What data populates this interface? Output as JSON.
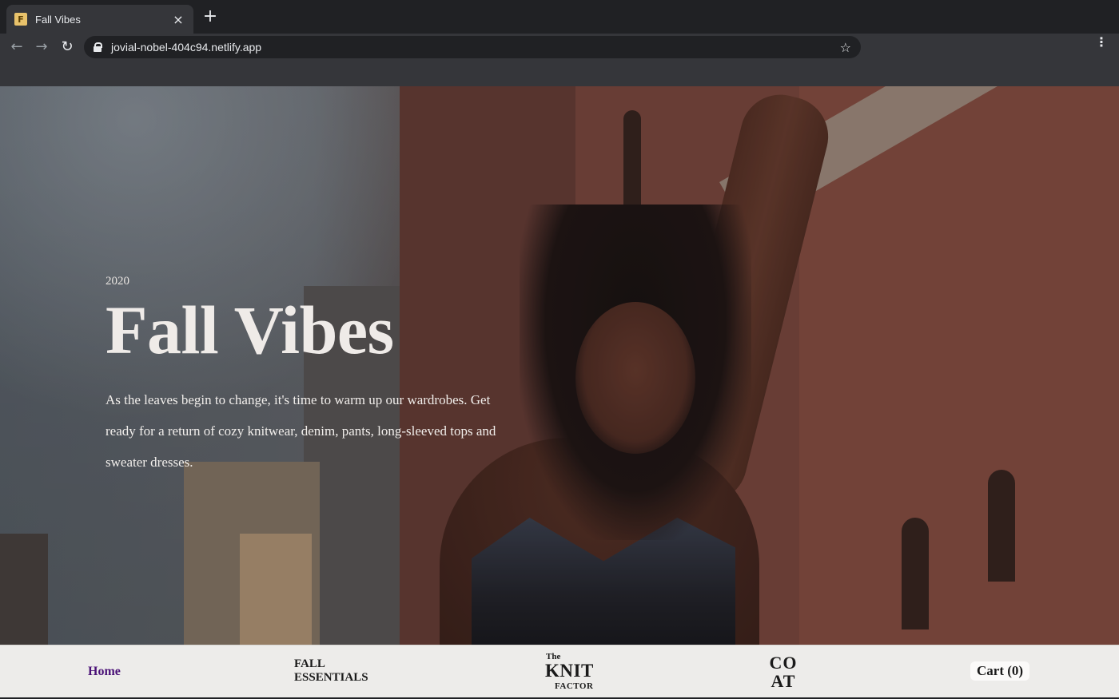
{
  "browser": {
    "tab_title": "Fall Vibes",
    "favicon_letter": "F",
    "close_icon": "×",
    "new_tab_icon": "+",
    "url": "jovial-nobel-404c94.netlify.app",
    "back_icon": "←",
    "forward_icon": "→",
    "reload_icon": "↻",
    "bookmark_icon": "☆",
    "menu_icon": "⋮"
  },
  "hero": {
    "year": "2020",
    "title": "Fall Vibes",
    "description": "As the leaves begin to change, it's time to warm up our wardrobes. Get ready for a return of cozy knitwear, denim, pants, long-sleeved tops and sweater dresses."
  },
  "nav": {
    "home": "Home",
    "fall_line1": "FALL",
    "fall_line2": "ESSENTIALS",
    "knit_the": "The",
    "knit_main": "KNIT",
    "knit_factor": "FACTOR",
    "coat_line1": "CO",
    "coat_line2": "AT",
    "cart": "Cart (0)"
  },
  "colors": {
    "home_link": "#4a1177",
    "nav_background": "#edecea",
    "hero_text": "#efebe8"
  }
}
